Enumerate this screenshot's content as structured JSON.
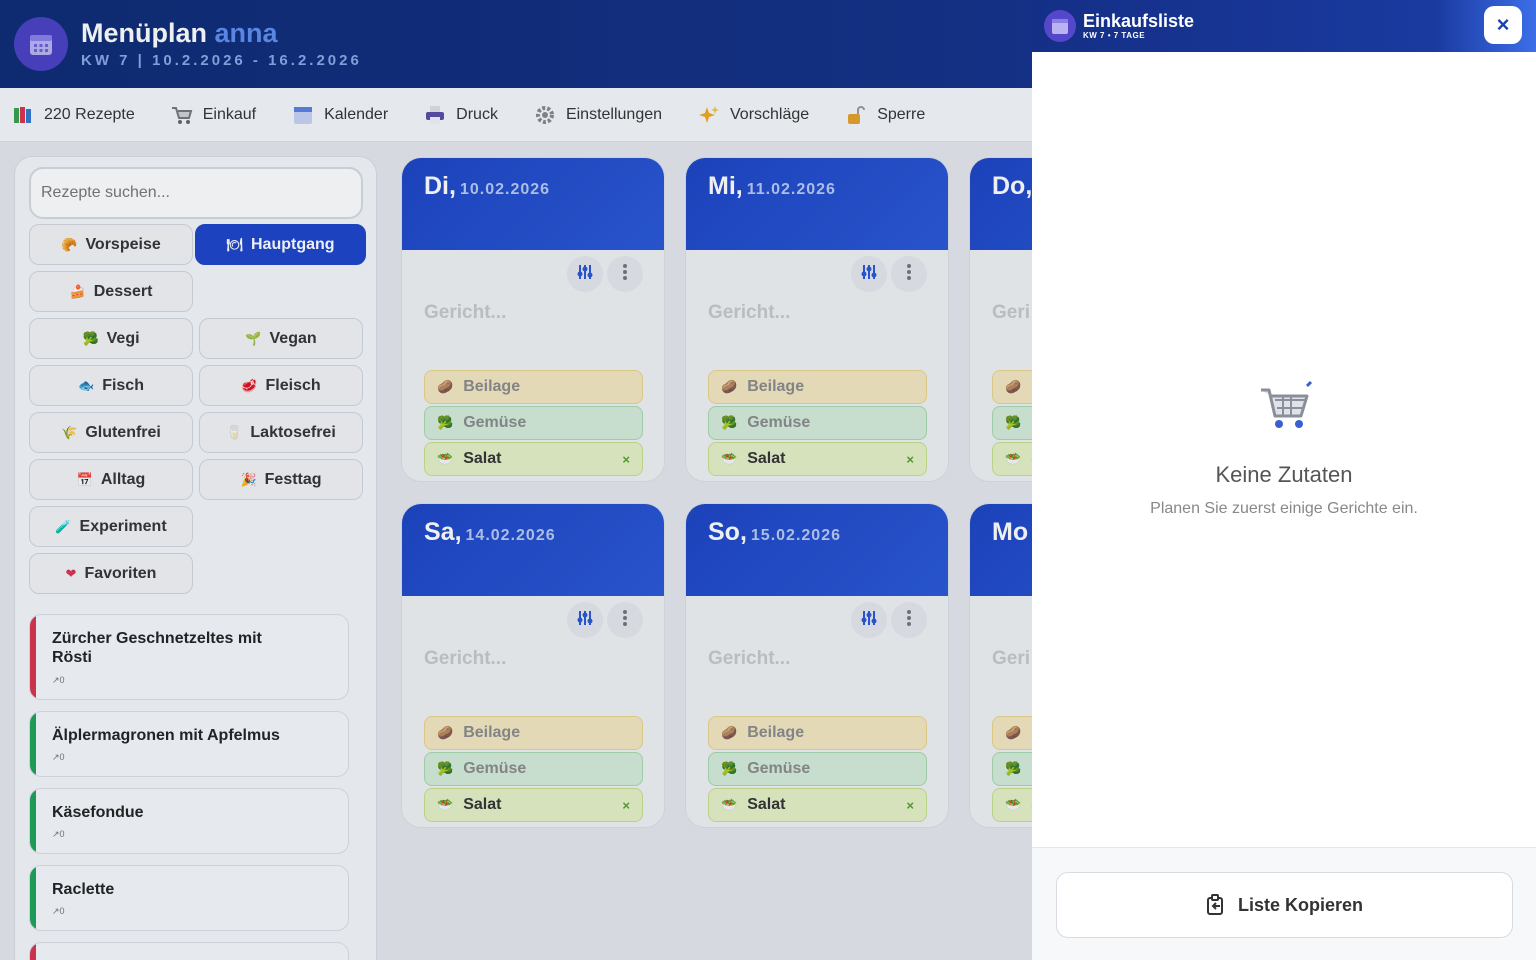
{
  "header": {
    "title": "Menüplan",
    "user": "anna",
    "subtitle": "KW 7 | 10.2.2026 - 16.2.2026"
  },
  "toolbar": {
    "items": [
      {
        "label": "220 Rezepte",
        "icon": "books-icon"
      },
      {
        "label": "Einkauf",
        "icon": "cart-icon"
      },
      {
        "label": "Kalender",
        "icon": "calendar-icon"
      },
      {
        "label": "Druck",
        "icon": "printer-icon"
      },
      {
        "label": "Einstellungen",
        "icon": "gear-icon"
      },
      {
        "label": "Vorschläge",
        "icon": "sparkles-icon"
      },
      {
        "label": "Sperre",
        "icon": "lock-icon"
      }
    ]
  },
  "sidebar": {
    "search_placeholder": "Rezepte suchen...",
    "filters": [
      {
        "label": "Vorspeise",
        "icon": "🥐"
      },
      {
        "label": "Hauptgang",
        "icon": "🍽",
        "active": true
      },
      {
        "label": "Dessert",
        "icon": "🍰"
      },
      {
        "label": "Vegi",
        "icon": "🥦"
      },
      {
        "label": "Vegan",
        "icon": "🌱"
      },
      {
        "label": "Fisch",
        "icon": "🐟"
      },
      {
        "label": "Fleisch",
        "icon": "🥩"
      },
      {
        "label": "Glutenfrei",
        "icon": "🌾"
      },
      {
        "label": "Laktosefrei",
        "icon": "🥛"
      },
      {
        "label": "Alltag",
        "icon": "📅"
      },
      {
        "label": "Festtag",
        "icon": "🎉"
      },
      {
        "label": "Experiment",
        "icon": "🧪"
      },
      {
        "label": "Favoriten",
        "icon": "❤"
      }
    ],
    "recipes": [
      {
        "name": "Zürcher Geschnetzeltes mit Rösti",
        "count": "0",
        "color": "#d9344f"
      },
      {
        "name": "Älplermagronen mit Apfelmus",
        "count": "0",
        "color": "#1fa35a"
      },
      {
        "name": "Käsefondue",
        "count": "0",
        "color": "#1fa35a"
      },
      {
        "name": "Raclette",
        "count": "0",
        "color": "#1fa35a"
      }
    ]
  },
  "days": [
    {
      "name": "Di,",
      "date": "10.02.2026"
    },
    {
      "name": "Mi,",
      "date": "11.02.2026"
    },
    {
      "name": "Do,",
      "date": ""
    },
    {
      "name": "Sa,",
      "date": "14.02.2026"
    },
    {
      "name": "So,",
      "date": "15.02.2026"
    },
    {
      "name": "Mo",
      "date": ""
    }
  ],
  "slots": {
    "gericht_placeholder": "Gericht...",
    "gericht_partial": "Geri",
    "beilage": "Beilage",
    "gemuese": "Gemüse",
    "salat": "Salat",
    "remove": "×"
  },
  "panel": {
    "title": "Einkaufsliste",
    "subtitle": "KW 7 • 7 TAGE",
    "close": "×",
    "empty_title": "Keine Zutaten",
    "empty_sub": "Planen Sie zuerst einige Gerichte ein.",
    "copy_label": "Liste Kopieren"
  },
  "colors": {
    "accent": "#1d44c9",
    "header": "#132f86"
  }
}
